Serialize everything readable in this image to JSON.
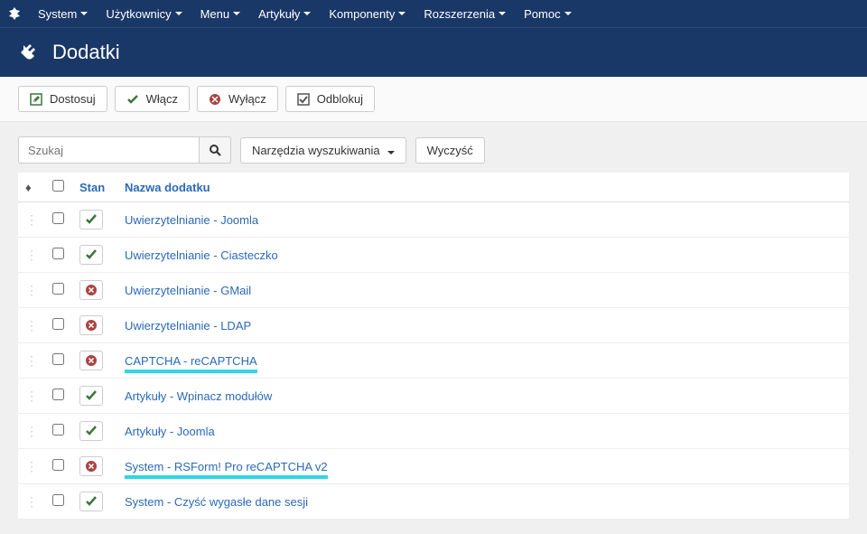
{
  "nav": {
    "items": [
      "System",
      "Użytkownicy",
      "Menu",
      "Artykuły",
      "Komponenty",
      "Rozszerzenia",
      "Pomoc"
    ]
  },
  "header": {
    "title": "Dodatki"
  },
  "toolbar": {
    "customize": "Dostosuj",
    "enable": "Włącz",
    "disable": "Wyłącz",
    "unlock": "Odblokuj"
  },
  "search": {
    "placeholder": "Szukaj",
    "tools": "Narzędzia wyszukiwania",
    "clear": "Wyczyść"
  },
  "table": {
    "headers": {
      "state": "Stan",
      "name": "Nazwa dodatku"
    },
    "rows": [
      {
        "name": "Uwierzytelnianie - Joomla",
        "enabled": true,
        "highlight": false
      },
      {
        "name": "Uwierzytelnianie - Ciasteczko",
        "enabled": true,
        "highlight": false
      },
      {
        "name": "Uwierzytelnianie - GMail",
        "enabled": false,
        "highlight": false
      },
      {
        "name": "Uwierzytelnianie - LDAP",
        "enabled": false,
        "highlight": false
      },
      {
        "name": "CAPTCHA - reCAPTCHA",
        "enabled": false,
        "highlight": true
      },
      {
        "name": "Artykuły - Wpinacz modułów",
        "enabled": true,
        "highlight": false
      },
      {
        "name": "Artykuły - Joomla",
        "enabled": true,
        "highlight": false
      },
      {
        "name": "System - RSForm! Pro reCAPTCHA v2",
        "enabled": false,
        "highlight": true
      },
      {
        "name": "System - Czyść wygasłe dane sesji",
        "enabled": true,
        "highlight": false
      }
    ]
  }
}
